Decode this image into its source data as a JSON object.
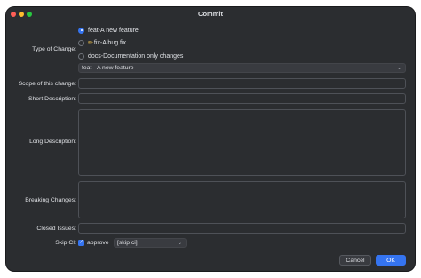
{
  "window": {
    "title": "Commit"
  },
  "type_of_change": {
    "label": "Type of Change:",
    "options": [
      {
        "label": "feat-A new feature",
        "selected": true,
        "icon": ""
      },
      {
        "label": "fix-A bug fix",
        "selected": false,
        "icon": "pencil-icon"
      },
      {
        "label": "docs-Documentation only changes",
        "selected": false,
        "icon": ""
      }
    ],
    "dropdown_value": "feat - A new feature"
  },
  "scope": {
    "label": "Scope of this change:",
    "value": ""
  },
  "short_description": {
    "label": "Short Description:",
    "value": ""
  },
  "long_description": {
    "label": "Long Description:",
    "value": ""
  },
  "breaking_changes": {
    "label": "Breaking Changes:",
    "value": ""
  },
  "closed_issues": {
    "label": "Closed Issues:",
    "value": ""
  },
  "skip_ci": {
    "label": "Skip CI:",
    "checkbox_label": "approve",
    "checked": true,
    "value": "[skip ci]"
  },
  "buttons": {
    "cancel": "Cancel",
    "ok": "OK"
  },
  "colors": {
    "accent": "#3574f0",
    "background": "#2b2d30",
    "field_border": "#4e5157"
  }
}
